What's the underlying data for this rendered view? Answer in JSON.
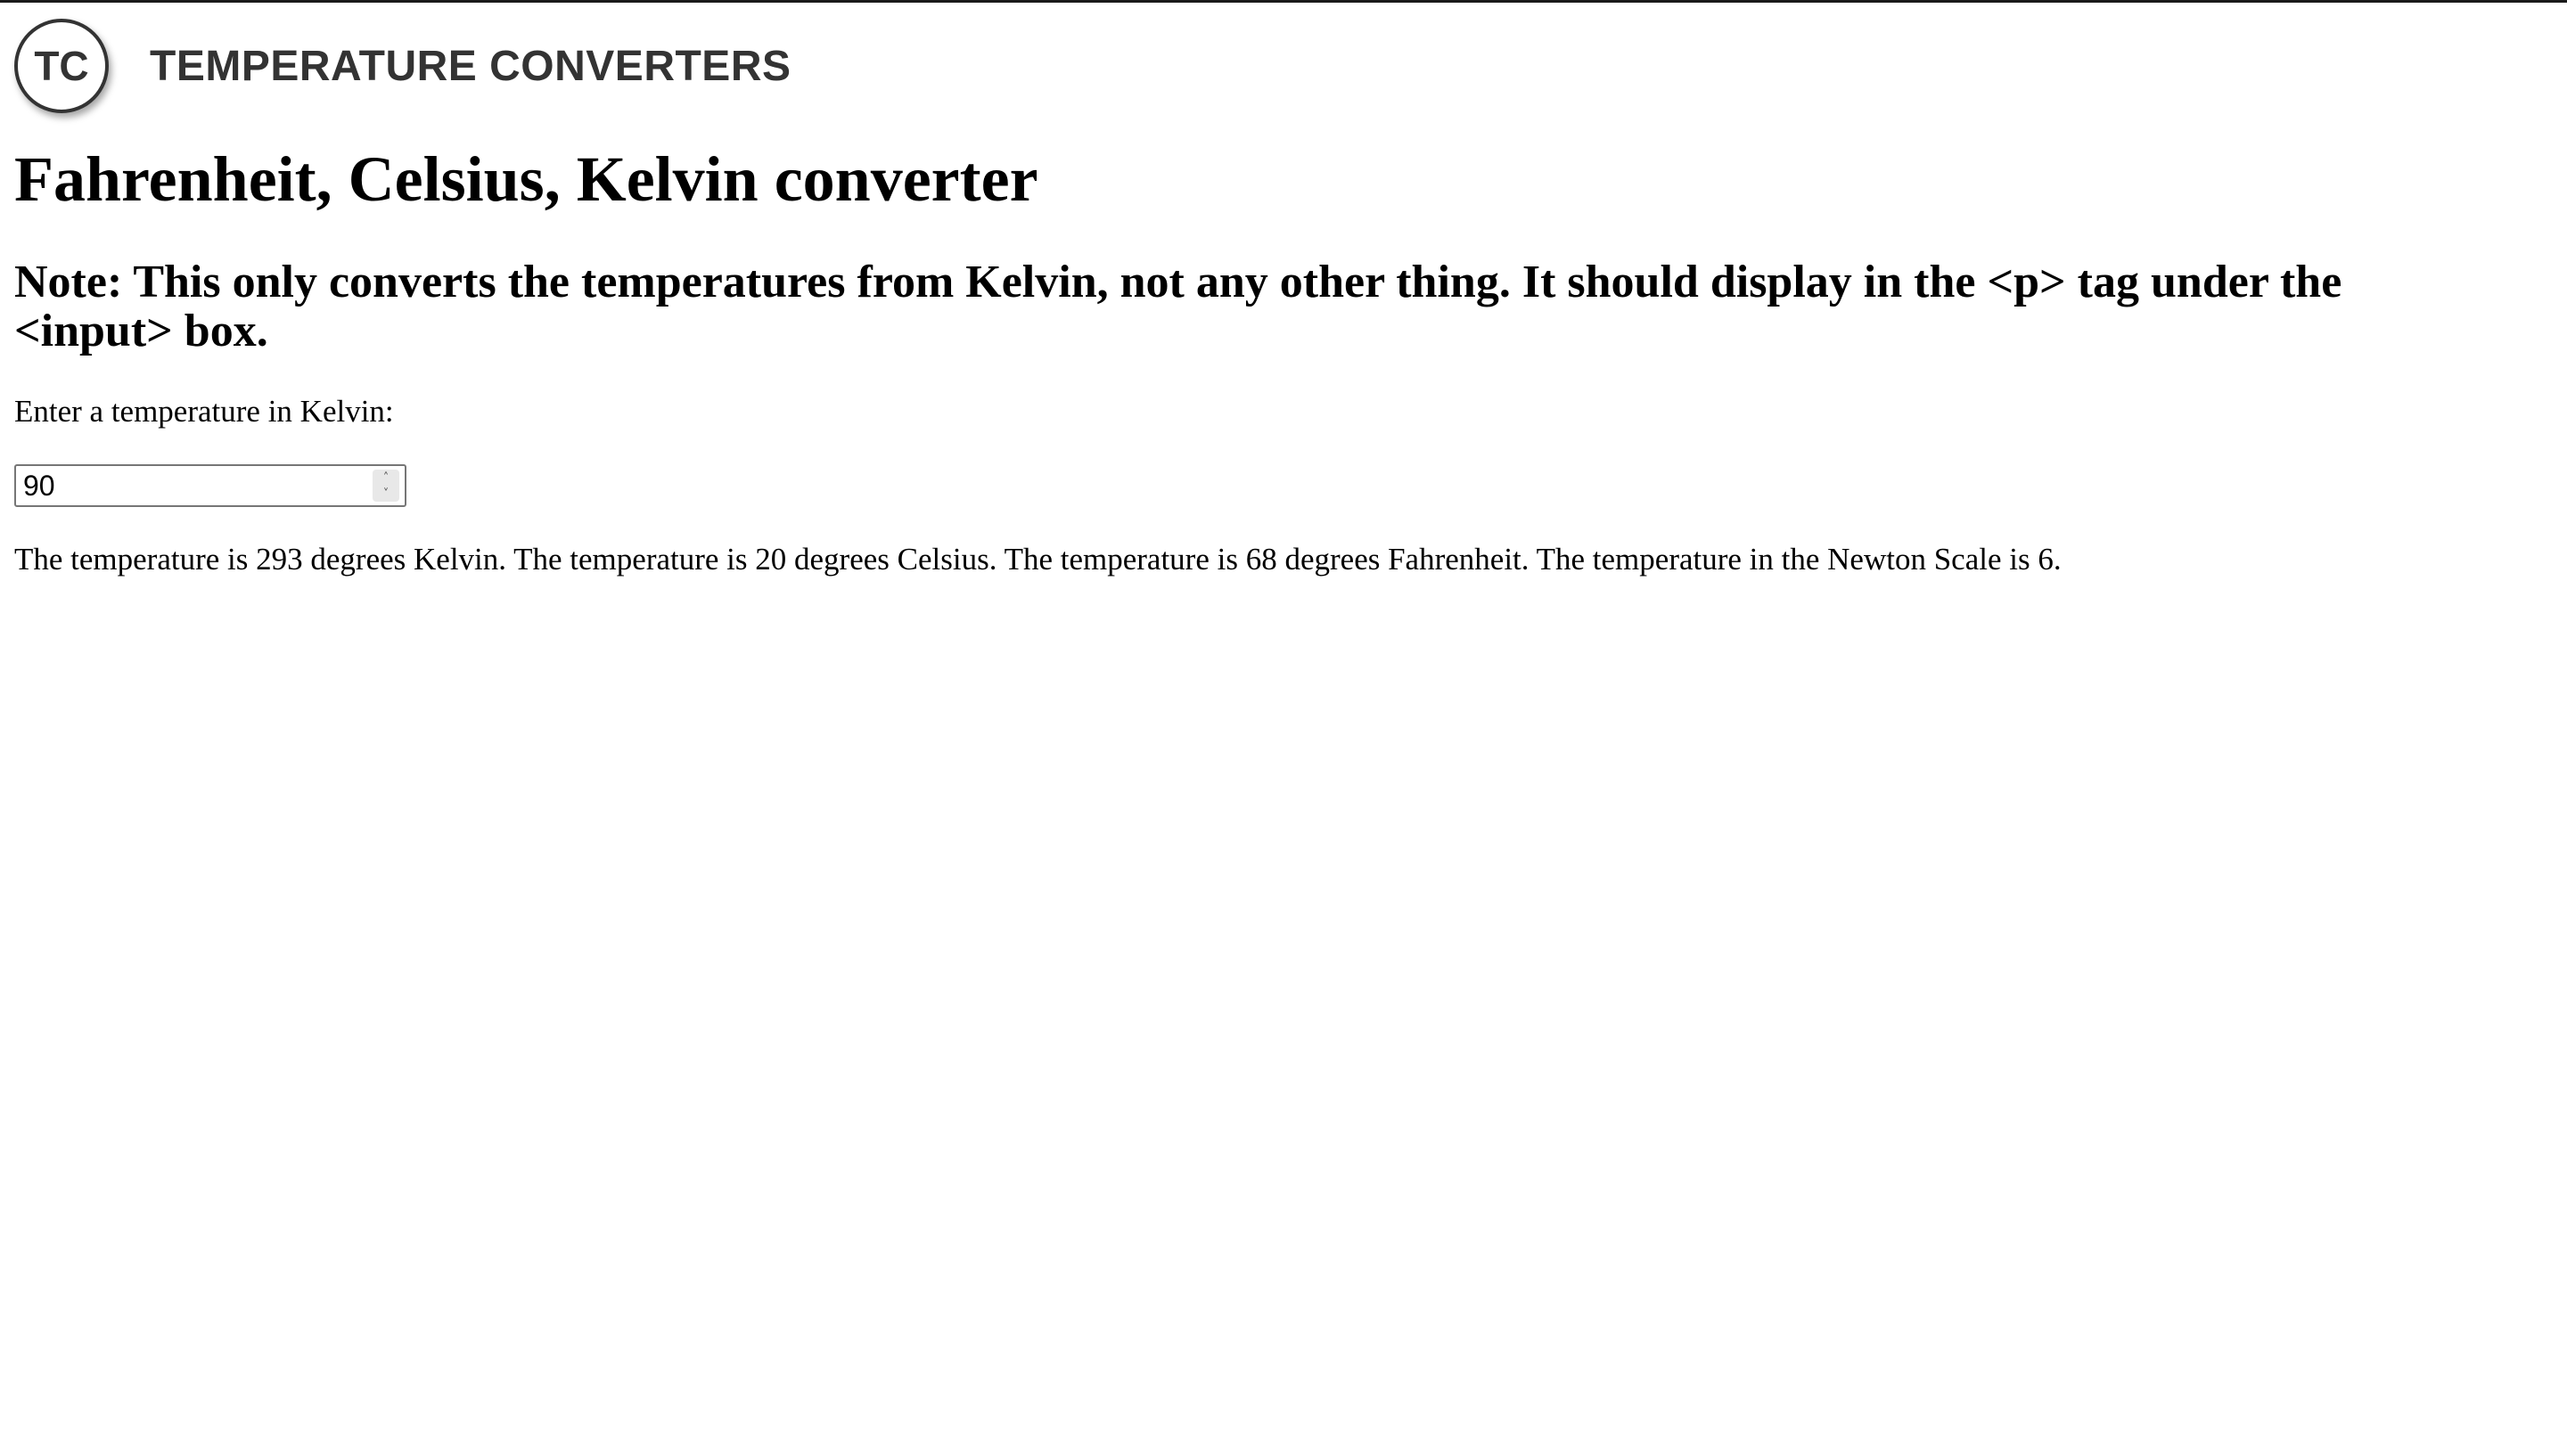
{
  "header": {
    "logo_text": "TC",
    "brand_title": "TEMPERATURE CONVERTERS"
  },
  "main": {
    "heading": "Fahrenheit, Celsius, Kelvin converter",
    "note": "Note: This only converts the temperatures from Kelvin, not any other thing. It should display in the <p> tag under the <input> box.",
    "prompt_label": "Enter a temperature in Kelvin:",
    "kelvin_input": {
      "value": "90"
    },
    "result_text": "The temperature is 293 degrees Kelvin. The temperature is 20 degrees Celsius. The temperature is 68 degrees Fahrenheit. The temperature in the Newton Scale is 6."
  },
  "icons": {
    "spinner_up": "chevron-up-icon",
    "spinner_down": "chevron-down-icon"
  }
}
